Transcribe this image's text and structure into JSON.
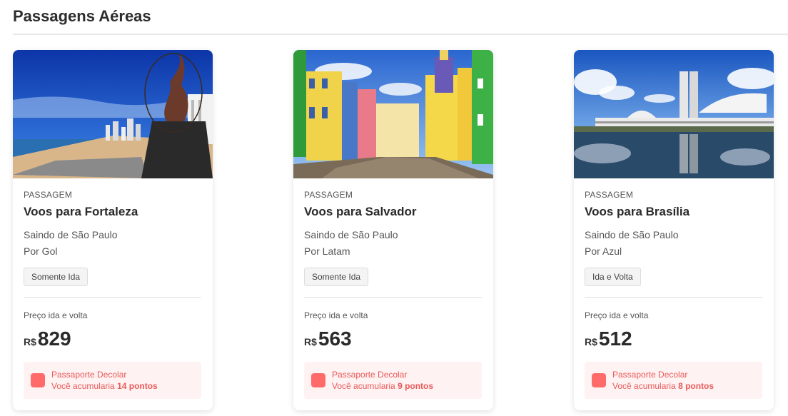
{
  "page": {
    "title": "Passagens Aéreas"
  },
  "cards": [
    {
      "kind": "PASSAGEM",
      "title": "Voos para Fortaleza",
      "origin": "Saindo de São Paulo",
      "airline": "Por Gol",
      "trip_type": "Somente Ida",
      "price_label": "Preço ida e volta",
      "currency": "R$",
      "price": "829",
      "loyalty_name": "Passaporte Decolar",
      "loyalty_prefix": "Você acumularia",
      "loyalty_points": "14 pontos",
      "image_icon": "fortaleza-beach-sculpture-photo"
    },
    {
      "kind": "PASSAGEM",
      "title": "Voos para Salvador",
      "origin": "Saindo de São Paulo",
      "airline": "Por Latam",
      "trip_type": "Somente Ida",
      "price_label": "Preço ida e volta",
      "currency": "R$",
      "price": "563",
      "loyalty_name": "Passaporte Decolar",
      "loyalty_prefix": "Você acumularia",
      "loyalty_points": "9 pontos",
      "image_icon": "salvador-pelourinho-photo"
    },
    {
      "kind": "PASSAGEM",
      "title": "Voos para Brasília",
      "origin": "Saindo de São Paulo",
      "airline": "Por Azul",
      "trip_type": "Ida e Volta",
      "price_label": "Preço ida e volta",
      "currency": "R$",
      "price": "512",
      "loyalty_name": "Passaporte Decolar",
      "loyalty_prefix": "Você acumularia",
      "loyalty_points": "8 pontos",
      "image_icon": "brasilia-congress-photo"
    }
  ],
  "colors": {
    "accent": "#ff6b6b",
    "loyalty_bg": "#fff2f2",
    "loyalty_text": "#e85a5a"
  }
}
